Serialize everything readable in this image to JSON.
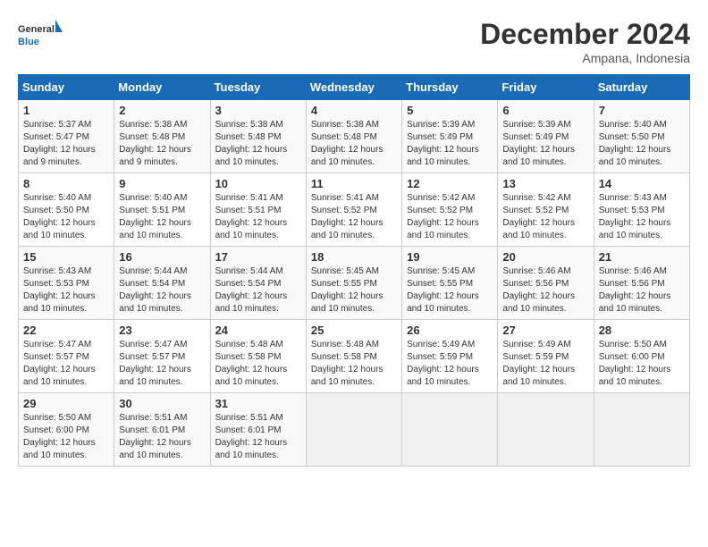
{
  "header": {
    "logo_line1": "General",
    "logo_line2": "Blue",
    "month": "December 2024",
    "location": "Ampana, Indonesia"
  },
  "columns": [
    "Sunday",
    "Monday",
    "Tuesday",
    "Wednesday",
    "Thursday",
    "Friday",
    "Saturday"
  ],
  "weeks": [
    [
      {
        "day": "1",
        "sunrise": "5:37 AM",
        "sunset": "5:47 PM",
        "daylight": "12 hours and 9 minutes."
      },
      {
        "day": "2",
        "sunrise": "5:38 AM",
        "sunset": "5:48 PM",
        "daylight": "12 hours and 9 minutes."
      },
      {
        "day": "3",
        "sunrise": "5:38 AM",
        "sunset": "5:48 PM",
        "daylight": "12 hours and 10 minutes."
      },
      {
        "day": "4",
        "sunrise": "5:38 AM",
        "sunset": "5:48 PM",
        "daylight": "12 hours and 10 minutes."
      },
      {
        "day": "5",
        "sunrise": "5:39 AM",
        "sunset": "5:49 PM",
        "daylight": "12 hours and 10 minutes."
      },
      {
        "day": "6",
        "sunrise": "5:39 AM",
        "sunset": "5:49 PM",
        "daylight": "12 hours and 10 minutes."
      },
      {
        "day": "7",
        "sunrise": "5:40 AM",
        "sunset": "5:50 PM",
        "daylight": "12 hours and 10 minutes."
      }
    ],
    [
      {
        "day": "8",
        "sunrise": "5:40 AM",
        "sunset": "5:50 PM",
        "daylight": "12 hours and 10 minutes."
      },
      {
        "day": "9",
        "sunrise": "5:40 AM",
        "sunset": "5:51 PM",
        "daylight": "12 hours and 10 minutes."
      },
      {
        "day": "10",
        "sunrise": "5:41 AM",
        "sunset": "5:51 PM",
        "daylight": "12 hours and 10 minutes."
      },
      {
        "day": "11",
        "sunrise": "5:41 AM",
        "sunset": "5:52 PM",
        "daylight": "12 hours and 10 minutes."
      },
      {
        "day": "12",
        "sunrise": "5:42 AM",
        "sunset": "5:52 PM",
        "daylight": "12 hours and 10 minutes."
      },
      {
        "day": "13",
        "sunrise": "5:42 AM",
        "sunset": "5:52 PM",
        "daylight": "12 hours and 10 minutes."
      },
      {
        "day": "14",
        "sunrise": "5:43 AM",
        "sunset": "5:53 PM",
        "daylight": "12 hours and 10 minutes."
      }
    ],
    [
      {
        "day": "15",
        "sunrise": "5:43 AM",
        "sunset": "5:53 PM",
        "daylight": "12 hours and 10 minutes."
      },
      {
        "day": "16",
        "sunrise": "5:44 AM",
        "sunset": "5:54 PM",
        "daylight": "12 hours and 10 minutes."
      },
      {
        "day": "17",
        "sunrise": "5:44 AM",
        "sunset": "5:54 PM",
        "daylight": "12 hours and 10 minutes."
      },
      {
        "day": "18",
        "sunrise": "5:45 AM",
        "sunset": "5:55 PM",
        "daylight": "12 hours and 10 minutes."
      },
      {
        "day": "19",
        "sunrise": "5:45 AM",
        "sunset": "5:55 PM",
        "daylight": "12 hours and 10 minutes."
      },
      {
        "day": "20",
        "sunrise": "5:46 AM",
        "sunset": "5:56 PM",
        "daylight": "12 hours and 10 minutes."
      },
      {
        "day": "21",
        "sunrise": "5:46 AM",
        "sunset": "5:56 PM",
        "daylight": "12 hours and 10 minutes."
      }
    ],
    [
      {
        "day": "22",
        "sunrise": "5:47 AM",
        "sunset": "5:57 PM",
        "daylight": "12 hours and 10 minutes."
      },
      {
        "day": "23",
        "sunrise": "5:47 AM",
        "sunset": "5:57 PM",
        "daylight": "12 hours and 10 minutes."
      },
      {
        "day": "24",
        "sunrise": "5:48 AM",
        "sunset": "5:58 PM",
        "daylight": "12 hours and 10 minutes."
      },
      {
        "day": "25",
        "sunrise": "5:48 AM",
        "sunset": "5:58 PM",
        "daylight": "12 hours and 10 minutes."
      },
      {
        "day": "26",
        "sunrise": "5:49 AM",
        "sunset": "5:59 PM",
        "daylight": "12 hours and 10 minutes."
      },
      {
        "day": "27",
        "sunrise": "5:49 AM",
        "sunset": "5:59 PM",
        "daylight": "12 hours and 10 minutes."
      },
      {
        "day": "28",
        "sunrise": "5:50 AM",
        "sunset": "6:00 PM",
        "daylight": "12 hours and 10 minutes."
      }
    ],
    [
      {
        "day": "29",
        "sunrise": "5:50 AM",
        "sunset": "6:00 PM",
        "daylight": "12 hours and 10 minutes."
      },
      {
        "day": "30",
        "sunrise": "5:51 AM",
        "sunset": "6:01 PM",
        "daylight": "12 hours and 10 minutes."
      },
      {
        "day": "31",
        "sunrise": "5:51 AM",
        "sunset": "6:01 PM",
        "daylight": "12 hours and 10 minutes."
      },
      null,
      null,
      null,
      null
    ]
  ]
}
